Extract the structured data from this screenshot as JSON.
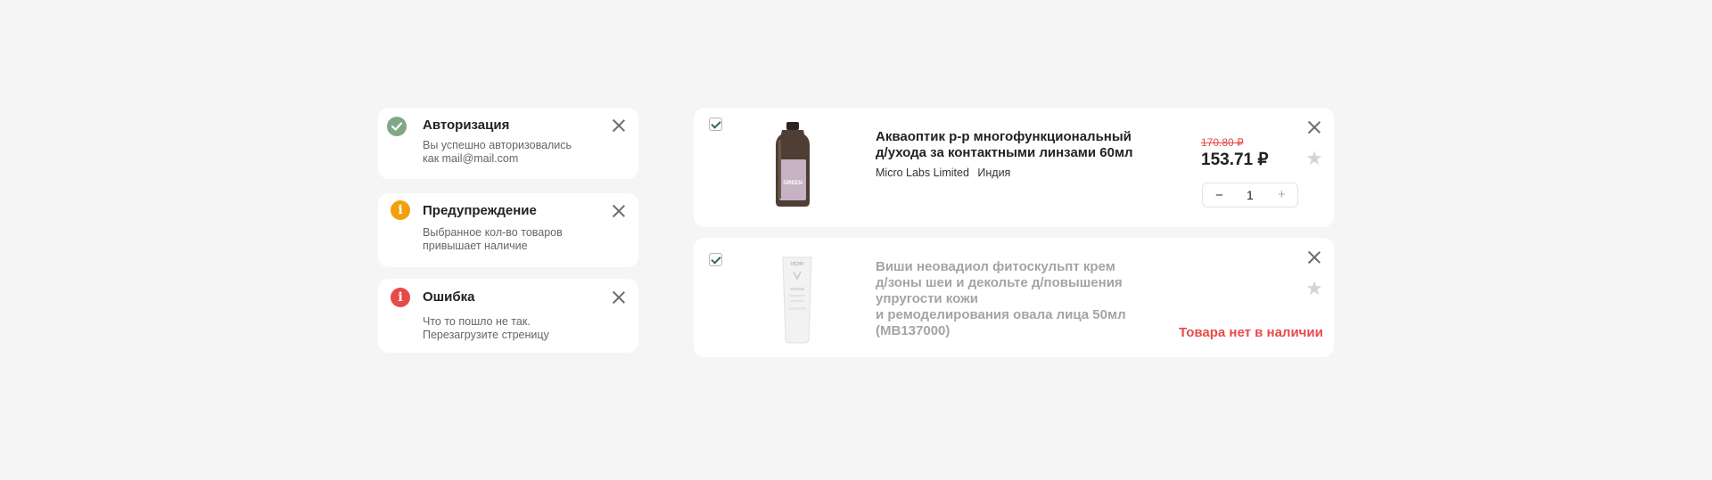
{
  "notifications": [
    {
      "title": "Авторизация",
      "message_line1": "Вы успешно авторизовались",
      "message_line2": "как mail@mail.com",
      "status": "success",
      "color": "#7fa886",
      "icon": "checkmark-icon"
    },
    {
      "title": "Предупреждение",
      "message_line1": "Выбранное кол-во товаров",
      "message_line2": "привышает наличие",
      "status": "warning",
      "color": "#f0a10b",
      "icon": "info-icon"
    },
    {
      "title": "Ошибка",
      "message_line1": "Что то пошло не так.",
      "message_line2": "Перезагрузите стреницу",
      "status": "error",
      "color": "#e84a4a",
      "icon": "info-icon"
    }
  ],
  "cart": {
    "items": [
      {
        "name_line1": "Акваоптик р-р многофункциональный",
        "name_line2": "д/ухода за контактными линзами 60мл",
        "manufacturer": "Micro Labs Limited",
        "country": "Индия",
        "old_price": "170.80 ₽",
        "price": "153.71 ₽",
        "quantity": "1",
        "minus_label": "−",
        "plus_label": "+",
        "checked": true
      },
      {
        "name_line1": "Виши неовадиол фитоскульпт крем",
        "name_line2": "д/зоны шеи и декольте д/повышения",
        "name_line3": "упругости кожи",
        "name_line4": "и ремоделирования овала лица 50мл",
        "name_line5": "(MB137000)",
        "availability": "Товара нет в наличии",
        "availability_color": "#e84a4a",
        "checked": true
      }
    ]
  },
  "bottle_label": "GREEN",
  "tube_brand": "VICHY"
}
